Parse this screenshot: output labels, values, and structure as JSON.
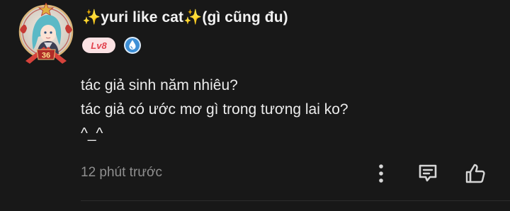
{
  "comment": {
    "username": "yuri like cat",
    "username_suffix": "(gì cũng đu)",
    "sparkle_glyph": "✨",
    "level_badge": "Lv8",
    "body_lines": [
      "tác giả sinh năm nhiêu?",
      "tác giả có ước mơ gì trong tương lai ko?",
      "^_^"
    ],
    "timestamp": "12 phút trước",
    "avatar_frame_number": "36"
  },
  "icons": {
    "more": "more-vertical-icon",
    "reply": "reply-comment-icon",
    "like": "thumbs-up-icon",
    "badge": "water-drop-badge-icon"
  },
  "colors": {
    "background": "#181818",
    "text": "#ececec",
    "muted": "#8f8f8f",
    "level_badge_bg": "#fbe2e4",
    "level_badge_text": "#e2434f",
    "member_badge": "#3d8fd6",
    "sparkle": "#f5c518"
  }
}
